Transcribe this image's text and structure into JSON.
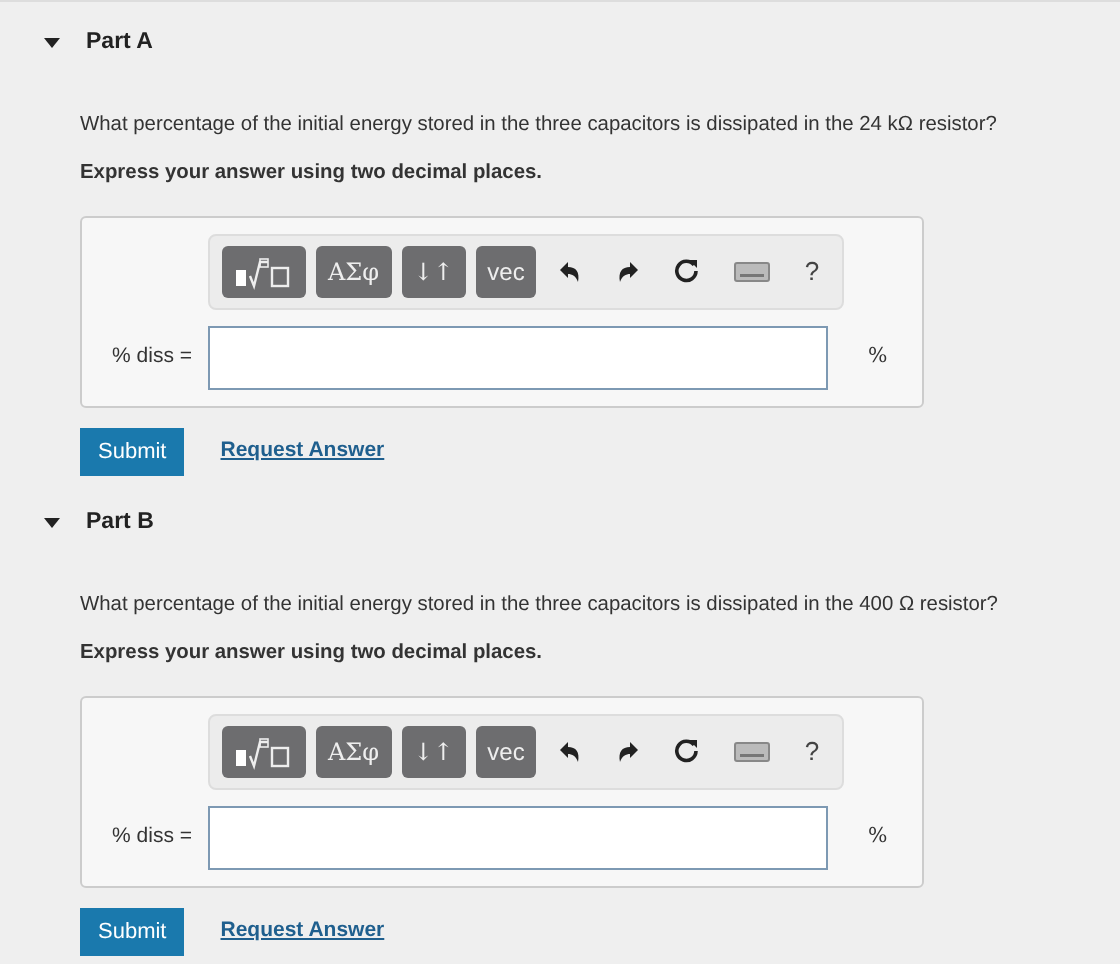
{
  "parts": [
    {
      "title": "Part A",
      "expanded": true,
      "question": "What percentage of the initial energy stored in the three capacitors is dissipated in the 24 kΩ resistor?",
      "instruction": "Express your answer using two decimal places.",
      "toolbar": [
        {
          "kind": "templates"
        },
        {
          "kind": "text",
          "label": "ΑΣφ"
        },
        {
          "kind": "text",
          "label": "↓↑"
        },
        {
          "kind": "text",
          "label": "vec"
        },
        {
          "kind": "undo"
        },
        {
          "kind": "redo"
        },
        {
          "kind": "reset"
        },
        {
          "kind": "keyboard"
        },
        {
          "kind": "help",
          "label": "?"
        }
      ],
      "answer_label": "% diss =",
      "unit": "%",
      "submit": "Submit",
      "request": "Request Answer"
    },
    {
      "title": "Part B",
      "expanded": true,
      "question": "What percentage of the initial energy stored in the three capacitors is dissipated in the 400 Ω resistor?",
      "instruction": "Express your answer using two decimal places.",
      "toolbar": [
        {
          "kind": "templates"
        },
        {
          "kind": "text",
          "label": "ΑΣφ"
        },
        {
          "kind": "text",
          "label": "↓↑"
        },
        {
          "kind": "text",
          "label": "vec"
        },
        {
          "kind": "undo"
        },
        {
          "kind": "redo"
        },
        {
          "kind": "reset"
        },
        {
          "kind": "keyboard"
        },
        {
          "kind": "help",
          "label": "?"
        }
      ],
      "answer_label": "% diss =",
      "unit": "%",
      "submit": "Submit",
      "request": "Request Answer"
    }
  ]
}
